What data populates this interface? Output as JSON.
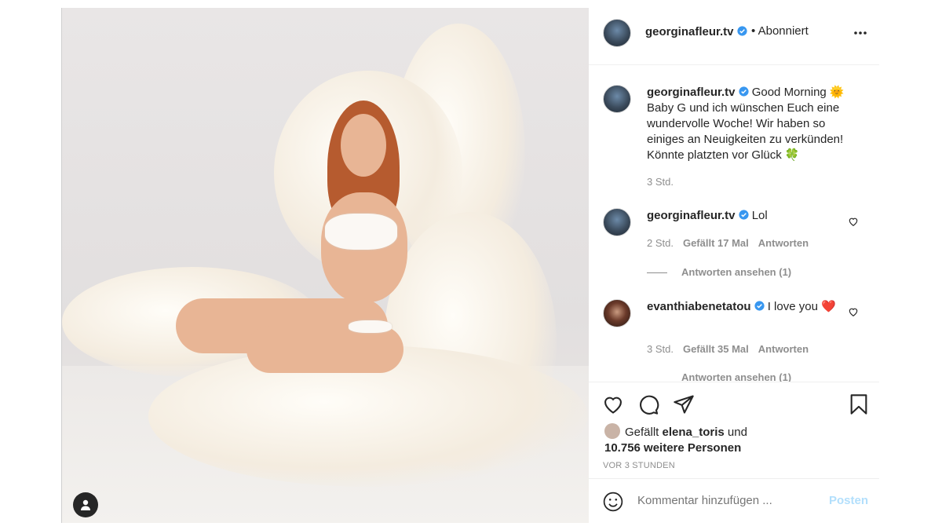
{
  "post": {
    "author": "georginafleur.tv",
    "follow_status": "• Abonniert"
  },
  "caption": {
    "username": "georginafleur.tv",
    "text": "Good Morning 🌞 Baby G und ich wünschen Euch eine wundervolle Woche! Wir haben so einiges an Neuigkeiten zu verkünden! Könnte platzten vor Glück 🍀",
    "time": "3 Std."
  },
  "comments": [
    {
      "username": "georginafleur.tv",
      "text": "Lol",
      "time": "2 Std.",
      "likes": "Gefällt 17 Mal",
      "reply": "Antworten",
      "view_replies": "Antworten ansehen (1)"
    },
    {
      "username": "evanthiabenetatou",
      "text": "I love you ❤️",
      "time": "3 Std.",
      "likes": "Gefällt 35 Mal",
      "reply": "Antworten",
      "view_replies": "Antworten ansehen (1)"
    }
  ],
  "likes_line": {
    "prefix": "Gefällt",
    "user": "elena_toris",
    "conj": "und",
    "others": "10.756 weitere Personen"
  },
  "timestamp": "VOR 3 STUNDEN",
  "comment_box": {
    "placeholder": "Kommentar hinzufügen ...",
    "post_label": "Posten"
  },
  "icons": {
    "verified_color": "#3897f0",
    "accent_post": "#b2dffc"
  }
}
